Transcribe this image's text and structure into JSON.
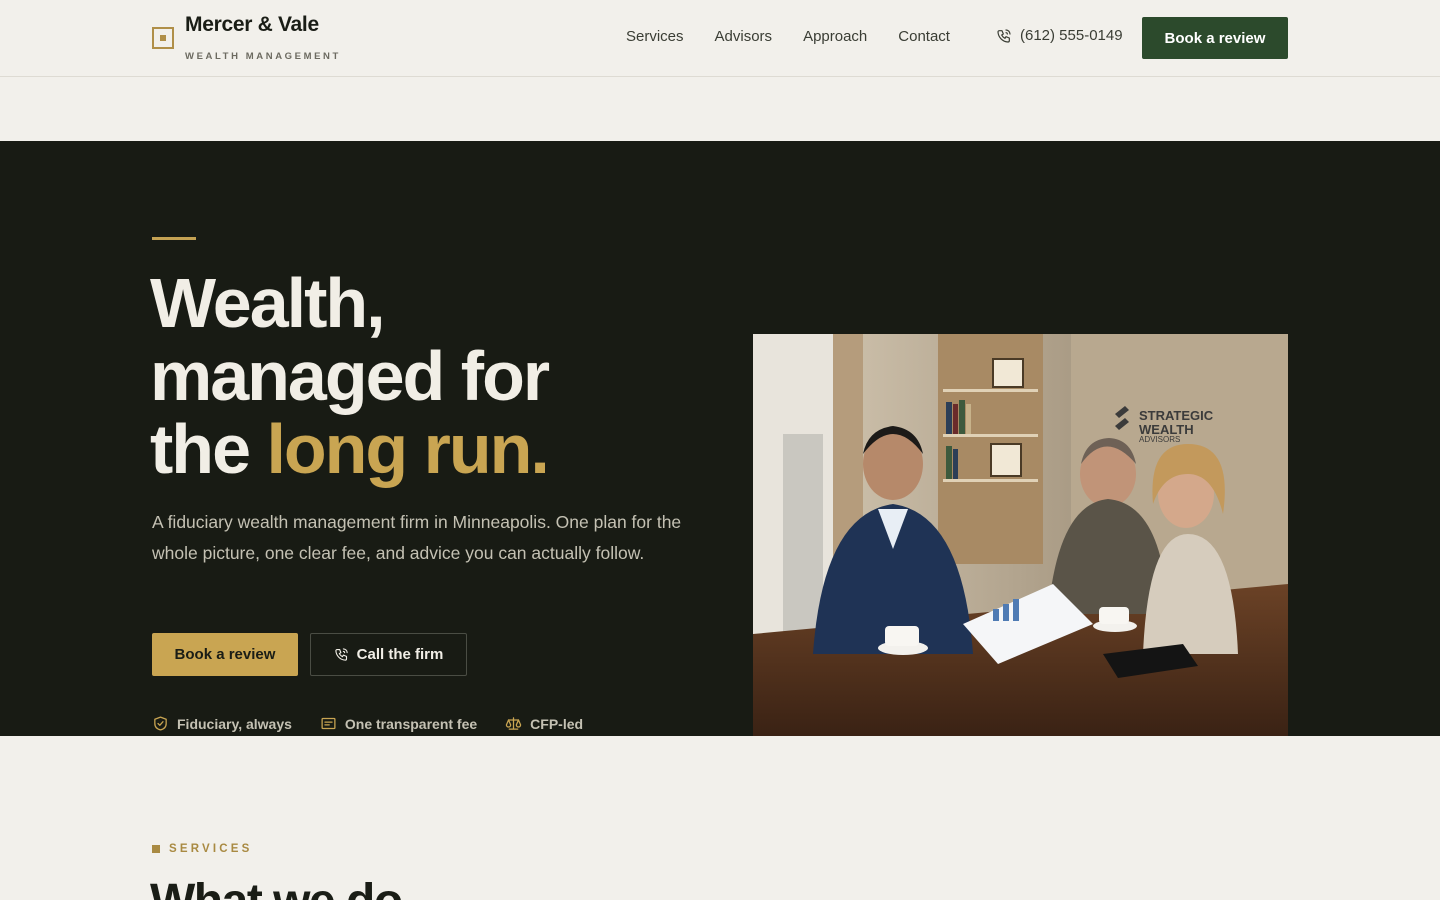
{
  "brand": {
    "name": "Mercer & Vale",
    "tagline": "WEALTH MANAGEMENT",
    "accent_color": "#c9a552",
    "primary_color": "#2c4a2c"
  },
  "nav": {
    "links": [
      "Services",
      "Advisors",
      "Approach",
      "Contact"
    ],
    "phone": "(612) 555-0149",
    "cta": "Book a review"
  },
  "hero": {
    "title_line1": "Wealth,",
    "title_line2": "managed for",
    "title_line3_plain": "the ",
    "title_line3_accent": "long run.",
    "description": "A fiduciary wealth management firm in Minneapolis. One plan for the whole picture, one clear fee, and advice you can actually follow.",
    "primary_cta": "Book a review",
    "secondary_cta": "Call the firm",
    "badges": [
      {
        "icon": "shield-check-icon",
        "label": "Fiduciary, always"
      },
      {
        "icon": "receipt-icon",
        "label": "One transparent fee"
      },
      {
        "icon": "scales-icon",
        "label": "CFP-led"
      }
    ],
    "image": {
      "description": "advisor-meeting-photo",
      "sign_text": [
        "STRATEGIC",
        "WEALTH",
        "ADVISORS"
      ]
    }
  },
  "services": {
    "eyebrow": "SERVICES",
    "title": "What we do"
  }
}
